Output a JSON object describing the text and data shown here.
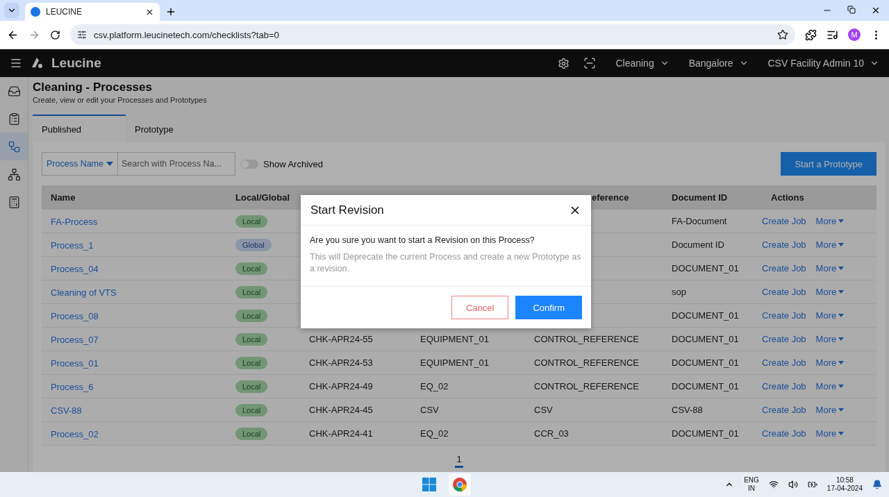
{
  "browser": {
    "tab_title": "LEUCINE",
    "url": "csv.platform.leucinetech.com/checklists?tab=0",
    "profile_initial": "M"
  },
  "app": {
    "logo": "Leucine",
    "menus": [
      {
        "label": "Cleaning"
      },
      {
        "label": "Bangalore"
      },
      {
        "label": "CSV Facility Admin 10"
      }
    ]
  },
  "sidebar": {
    "items": [
      {
        "kind": "inbox",
        "selected": false
      },
      {
        "kind": "checklist",
        "selected": false
      },
      {
        "kind": "process",
        "selected": true
      },
      {
        "kind": "hierarchy",
        "selected": false
      },
      {
        "kind": "report",
        "selected": false
      }
    ]
  },
  "page": {
    "title": "Cleaning - Processes",
    "subtitle": "Create, view or edit your Processes and Prototypes"
  },
  "tabs": [
    {
      "label": "Published",
      "selected": true
    },
    {
      "label": "Prototype",
      "selected": false
    }
  ],
  "toolbar": {
    "filter": "Process Name",
    "search_placeholder": "Search with Process Na...",
    "toggle": {
      "label": "Show Archived",
      "on": false
    },
    "button": "Start a Prototype"
  },
  "table": {
    "columns": [
      "Name",
      "Local/Global",
      "eference",
      "Document ID",
      "Actions"
    ],
    "rows": [
      {
        "name": "FA-Process",
        "scope": {
          "label": "Local",
          "kind": "local"
        },
        "document_id": "FA-Document",
        "actions": [
          "Create Job",
          "More"
        ]
      },
      {
        "name": "Process_1",
        "scope": {
          "label": "Global",
          "kind": "global"
        },
        "document_id": "Document ID",
        "actions": [
          "Create Job",
          "More"
        ]
      },
      {
        "name": "Process_04",
        "scope": {
          "label": "Local",
          "kind": "local"
        },
        "document_id": "DOCUMENT_01",
        "actions": [
          "Create Job",
          "More"
        ]
      },
      {
        "name": "Cleaning of VTS",
        "scope": {
          "label": "Local",
          "kind": "local"
        },
        "document_id": "sop",
        "actions": [
          "Create Job",
          "More"
        ]
      },
      {
        "name": "Process_08",
        "scope": {
          "label": "Local",
          "kind": "local"
        },
        "document_id": "DOCUMENT_01",
        "actions": [
          "Create Job",
          "More"
        ]
      },
      {
        "name": "Process_07",
        "scope": {
          "label": "Local",
          "kind": "local"
        },
        "code": "CHK-APR24-55",
        "equipment": "EQUIPMENT_01",
        "reference": "CONTROL_REFERENCE",
        "document_id": "DOCUMENT_01",
        "actions": [
          "Create Job",
          "More"
        ]
      },
      {
        "name": "Process_01",
        "scope": {
          "label": "Local",
          "kind": "local"
        },
        "code": "CHK-APR24-53",
        "equipment": "EQUIPMENT_01",
        "reference": "CONTROL_REFERENCE",
        "document_id": "DOCUMENT_01",
        "actions": [
          "Create Job",
          "More"
        ]
      },
      {
        "name": "Process_6",
        "scope": {
          "label": "Local",
          "kind": "local"
        },
        "code": "CHK-APR24-49",
        "equipment": "EQ_02",
        "reference": "CONTROL_REFERENCE",
        "document_id": "DOCUMENT_01",
        "actions": [
          "Create Job",
          "More"
        ]
      },
      {
        "name": "CSV-88",
        "scope": {
          "label": "Local",
          "kind": "local"
        },
        "code": "CHK-APR24-45",
        "equipment": "CSV",
        "reference": "CSV",
        "document_id": "CSV-88",
        "actions": [
          "Create Job",
          "More"
        ]
      },
      {
        "name": "Process_02",
        "scope": {
          "label": "Local",
          "kind": "local"
        },
        "code": "CHK-APR24-41",
        "equipment": "EQ_02",
        "reference": "CCR_03",
        "document_id": "DOCUMENT_01",
        "actions": [
          "Create Job",
          "More"
        ]
      }
    ]
  },
  "pagination": [
    {
      "label": "1",
      "selected": true
    }
  ],
  "modal": {
    "title": "Start Revision",
    "question": "Are you sure you want to start a Revision on this Process?",
    "note": "This will Deprecate the current Process and create a new Prototype as a revision.",
    "buttons": [
      {
        "label": "Cancel",
        "kind": "secondary"
      },
      {
        "label": "Confirm",
        "kind": "primary"
      }
    ]
  },
  "taskbar": {
    "language": "ENG",
    "region": "IN",
    "time": "10:58",
    "date": "17-04-2024"
  }
}
